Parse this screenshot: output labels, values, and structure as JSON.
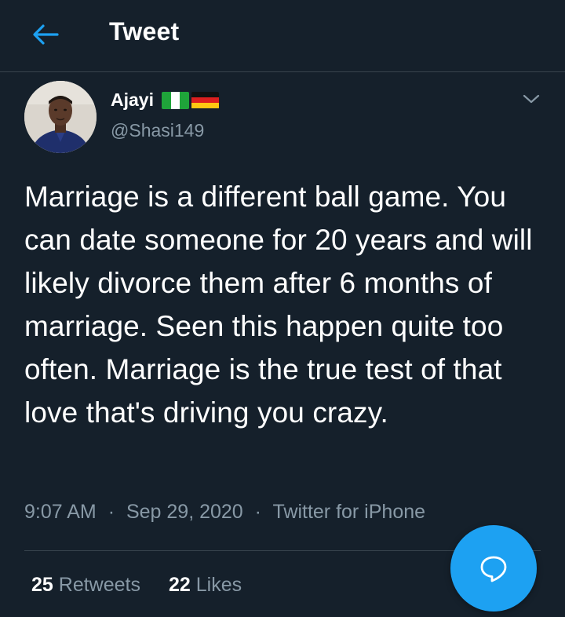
{
  "header": {
    "title": "Tweet",
    "back_icon": "arrow-left-icon"
  },
  "tweet": {
    "author": {
      "name": "Ajayi",
      "handle": "@Shasi149",
      "flags": [
        "nigeria-flag",
        "germany-flag"
      ]
    },
    "text": "Marriage is a different ball game. You can date someone for 20 years and will likely divorce them after 6 months of marriage. Seen this happen quite too often. Marriage is the true test of that love that's driving you crazy.",
    "time": "9:07 AM",
    "separator": "·",
    "date": "Sep 29, 2020",
    "source": "Twitter for iPhone",
    "stats": {
      "retweets_count": "25",
      "retweets_label": "Retweets",
      "likes_count": "22",
      "likes_label": "Likes"
    }
  },
  "fab": {
    "icon": "reply-bubble-icon"
  },
  "colors": {
    "background": "#15202b",
    "accent": "#1da1f2",
    "muted_text": "#8899a6",
    "divider": "#38444d"
  }
}
